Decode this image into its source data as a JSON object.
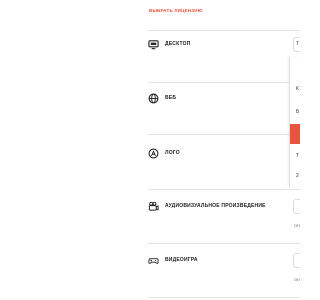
{
  "header": {
    "choose_license_label": "ВЫБРАТЬ ЛИЦЕНЗИЮ"
  },
  "rows": [
    {
      "label": "ДЕСКТОП",
      "icon": "monitor-icon",
      "select_value": "Т"
    },
    {
      "label": "ВЕБ",
      "icon": "globe-icon",
      "select_value": ""
    },
    {
      "label": "ЛОГО",
      "icon": "logo-icon",
      "select_value": ""
    },
    {
      "label": "АУДИОВИЗУАЛЬНОЕ ПРОИЗВЕДЕНИЕ",
      "icon": "video-camera-icon",
      "select_value": "",
      "note": "ОП"
    },
    {
      "label": "ВИДЕОИГРА",
      "icon": "gamepad-icon",
      "select_value": "",
      "note": "ОП"
    }
  ],
  "dropdown": {
    "items": [
      {
        "label": "",
        "active": false
      },
      {
        "label": "К",
        "active": false
      },
      {
        "label": "Б",
        "active": false
      },
      {
        "label": "",
        "active": true
      },
      {
        "label": "Т",
        "active": false
      },
      {
        "label": "2",
        "active": false
      }
    ]
  },
  "colors": {
    "accent": "#e8553e"
  }
}
